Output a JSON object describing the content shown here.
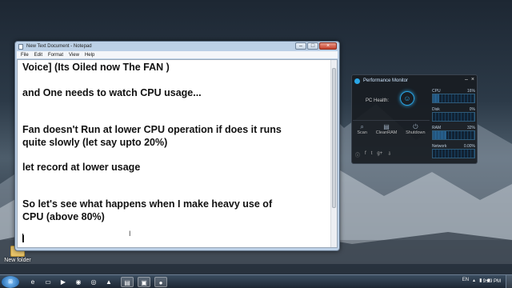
{
  "desktop": {
    "icons": [
      {
        "label": "New folder",
        "icon": "folder-icon"
      }
    ]
  },
  "notepad": {
    "title": "New Text Document - Notepad",
    "menu": [
      "File",
      "Edit",
      "Format",
      "View",
      "Help"
    ],
    "lines": [
      "Voice]  (Its Oiled now The FAN )",
      "and One needs to watch CPU usage...",
      "Fan doesn't Run at lower CPU operation if does it runs",
      "quite slowly   (let say upto 20%)",
      "let record at lower usage",
      "So let's see what happens when I make heavy use of",
      "CPU (above 80%)",
      "l"
    ]
  },
  "perf_monitor": {
    "title": "Performance Monitor",
    "pc_health_label": "PC Health:",
    "health_icon": "smiley-icon",
    "tools": [
      {
        "label": "Scan",
        "icon": "search-icon"
      },
      {
        "label": "CleanRAM",
        "icon": "memory-icon"
      },
      {
        "label": "Shutdown",
        "icon": "power-icon"
      }
    ],
    "social_icons": [
      "info-icon",
      "facebook-icon",
      "twitter-icon",
      "google-plus-icon",
      "download-icon"
    ],
    "metrics": [
      {
        "label": "CPU",
        "value": "16%",
        "level": 0.16
      },
      {
        "label": "Disk",
        "value": "0%",
        "level": 0.0
      },
      {
        "label": "RAM",
        "value": "32%",
        "level": 0.32
      },
      {
        "label": "Network",
        "value": "0.00%",
        "level": 0.0
      }
    ]
  },
  "taskbar": {
    "start_icon": "windows-start-icon",
    "apps": [
      {
        "icon": "ie-icon",
        "active": false
      },
      {
        "icon": "explorer-icon",
        "active": false
      },
      {
        "icon": "media-player-icon",
        "active": false
      },
      {
        "icon": "firefox-icon",
        "active": false
      },
      {
        "icon": "chrome-icon",
        "active": false
      },
      {
        "icon": "vlc-icon",
        "active": false
      },
      {
        "icon": "notepad-icon",
        "active": true
      },
      {
        "icon": "app-icon",
        "active": true
      },
      {
        "icon": "recorder-icon",
        "active": true
      }
    ],
    "language": "EN",
    "time": "9:29 PM"
  }
}
